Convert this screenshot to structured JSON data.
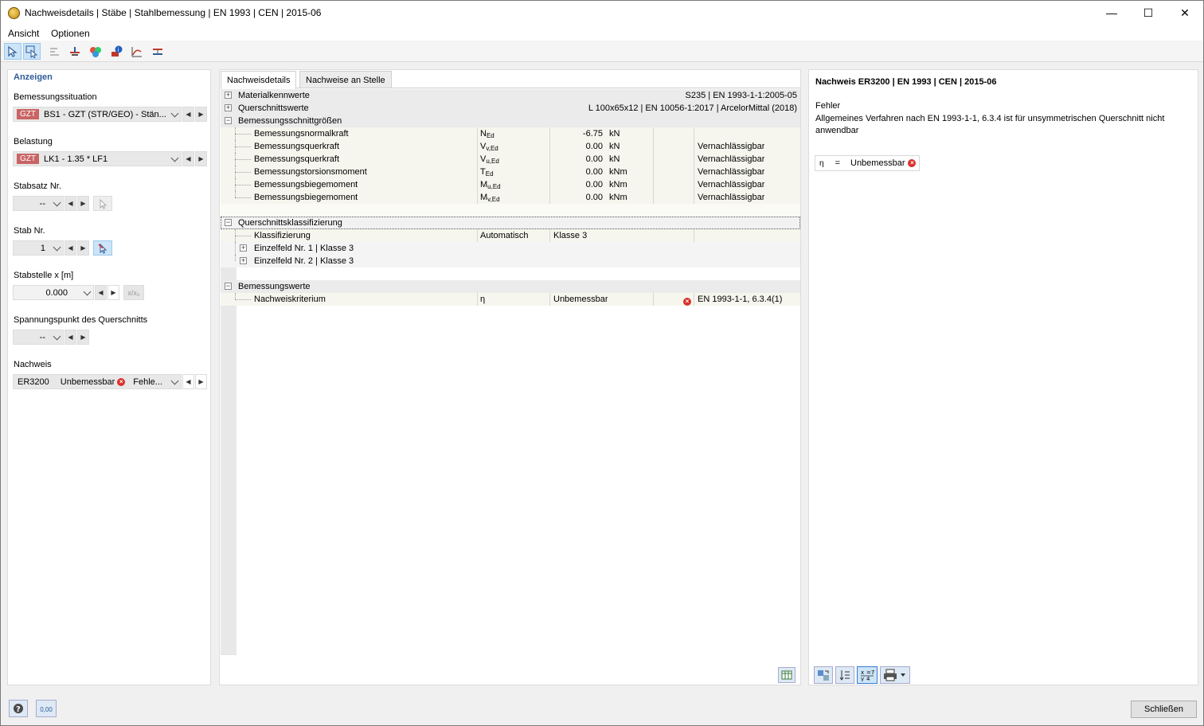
{
  "window": {
    "title": "Nachweisdetails | Stäbe | Stahlbemessung | EN 1993 | CEN | 2015-06",
    "minimize": "—",
    "maximize": "☐",
    "close": "✕"
  },
  "menu": [
    "Ansicht",
    "Optionen"
  ],
  "toolbar": {
    "icons": [
      "select-member-icon",
      "select-on-view-icon",
      "align-icon",
      "member-icon",
      "colors-icon",
      "info-icon",
      "diagram-icon",
      "stress-icon"
    ]
  },
  "left": {
    "header": "Anzeigen",
    "design_situation": {
      "label": "Bemessungssituation",
      "tag": "GZT",
      "value": "BS1 - GZT (STR/GEO) - Stän..."
    },
    "loading": {
      "label": "Belastung",
      "tag": "GZT",
      "value": "LK1 - 1.35 * LF1"
    },
    "member_set": {
      "label": "Stabsatz Nr.",
      "value": "--"
    },
    "member": {
      "label": "Stab Nr.",
      "value": "1"
    },
    "location": {
      "label": "Stabstelle x [m]",
      "value": "0.000",
      "relbtn": "x/x₀"
    },
    "stress_point": {
      "label": "Spannungspunkt des Querschnitts",
      "value": "--"
    },
    "check": {
      "label": "Nachweis",
      "id": "ER3200",
      "status": "Unbemessbar",
      "type": "Fehle..."
    }
  },
  "center": {
    "tabs": [
      "Nachweisdetails",
      "Nachweise an Stelle"
    ],
    "sections": {
      "material": {
        "label": "Materialkennwerte",
        "value": "S235 | EN 1993-1-1:2005-05"
      },
      "crosssection": {
        "label": "Querschnittswerte",
        "value": "L 100x65x12 | EN 10056-1:2017 | ArcelorMittal (2018)"
      },
      "forces": {
        "label": "Bemessungsschnittgrößen"
      },
      "classification": {
        "label": "Querschnittsklassifizierung"
      },
      "design": {
        "label": "Bemessungswerte"
      }
    },
    "force_rows": [
      {
        "name": "Bemessungsnormalkraft",
        "sym": "N",
        "sub": "Ed",
        "value": "-6.75",
        "unit": "kN",
        "note": ""
      },
      {
        "name": "Bemessungsquerkraft",
        "sym": "V",
        "sub": "v,Ed",
        "value": "0.00",
        "unit": "kN",
        "note": "Vernachlässigbar"
      },
      {
        "name": "Bemessungsquerkraft",
        "sym": "V",
        "sub": "u,Ed",
        "value": "0.00",
        "unit": "kN",
        "note": "Vernachlässigbar"
      },
      {
        "name": "Bemessungstorsionsmoment",
        "sym": "T",
        "sub": "Ed",
        "value": "0.00",
        "unit": "kNm",
        "note": "Vernachlässigbar"
      },
      {
        "name": "Bemessungsbiegemoment",
        "sym": "M",
        "sub": "u,Ed",
        "value": "0.00",
        "unit": "kNm",
        "note": "Vernachlässigbar"
      },
      {
        "name": "Bemessungsbiegemoment",
        "sym": "M",
        "sub": "v,Ed",
        "value": "0.00",
        "unit": "kNm",
        "note": "Vernachlässigbar"
      }
    ],
    "class_rows": {
      "classification": {
        "name": "Klassifizierung",
        "method": "Automatisch",
        "result": "Klasse 3"
      },
      "field1": "Einzelfeld Nr. 1 | Klasse 3",
      "field2": "Einzelfeld Nr. 2 | Klasse 3"
    },
    "design_row": {
      "name": "Nachweiskriterium",
      "sym": "η",
      "value": "Unbemessbar",
      "ref": "EN 1993-1-1, 6.3.4(1)"
    }
  },
  "right": {
    "title": "Nachweis ER3200 | EN 1993 | CEN | 2015-06",
    "error_label": "Fehler",
    "error_text": "Allgemeines Verfahren nach EN 1993-1-1, 6.3.4 ist für unsymmetrischen Querschnitt nicht anwendbar",
    "eta_sym": "η",
    "eta_eq": "=",
    "eta_value": "Unbemessbar"
  },
  "bottom": {
    "close_button": "Schließen",
    "units_icon_text": "0,00"
  },
  "colors": {
    "accent": "#2e5c9a",
    "gzt_tag": "#c96464",
    "error": "#d9312b",
    "section_bg": "#ebebeb",
    "subrow_bg": "#f6f6ee"
  }
}
